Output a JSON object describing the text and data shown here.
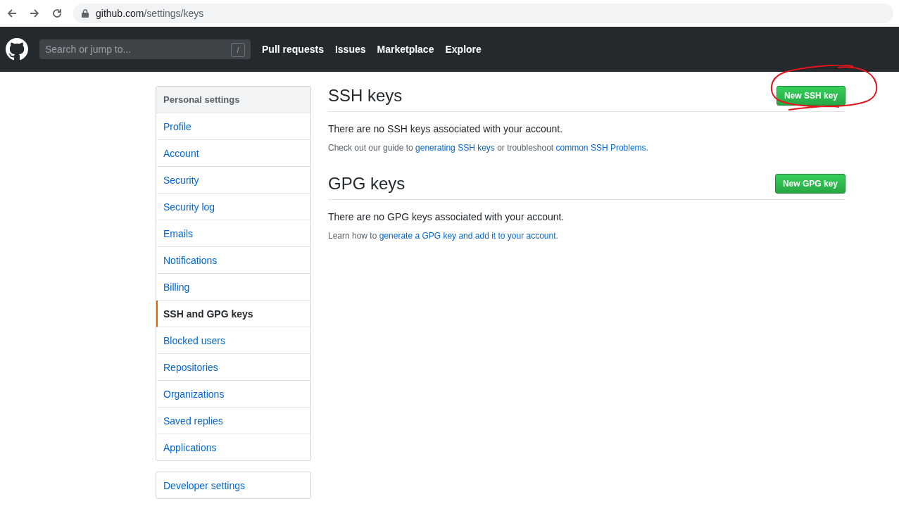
{
  "browser": {
    "url_host": "github.com",
    "url_path": "/settings/keys"
  },
  "header": {
    "search": {
      "placeholder": "Search or jump to..."
    },
    "slash_key": "/",
    "nav": [
      "Pull requests",
      "Issues",
      "Marketplace",
      "Explore"
    ]
  },
  "sidebar": {
    "heading": "Personal settings",
    "items": [
      {
        "label": "Profile",
        "selected": false
      },
      {
        "label": "Account",
        "selected": false
      },
      {
        "label": "Security",
        "selected": false
      },
      {
        "label": "Security log",
        "selected": false
      },
      {
        "label": "Emails",
        "selected": false
      },
      {
        "label": "Notifications",
        "selected": false
      },
      {
        "label": "Billing",
        "selected": false
      },
      {
        "label": "SSH and GPG keys",
        "selected": true
      },
      {
        "label": "Blocked users",
        "selected": false
      },
      {
        "label": "Repositories",
        "selected": false
      },
      {
        "label": "Organizations",
        "selected": false
      },
      {
        "label": "Saved replies",
        "selected": false
      },
      {
        "label": "Applications",
        "selected": false
      }
    ],
    "developer": "Developer settings"
  },
  "sections": [
    {
      "title": "SSH keys",
      "button": "New SSH key",
      "empty": "There are no SSH keys associated with your account.",
      "help": [
        {
          "text": "Check out our guide to ",
          "link": false
        },
        {
          "text": "generating SSH keys",
          "link": true
        },
        {
          "text": " or troubleshoot ",
          "link": false
        },
        {
          "text": "common SSH Problems",
          "link": true
        },
        {
          "text": ".",
          "link": false
        }
      ],
      "annotation": {
        "kind": "circle"
      }
    },
    {
      "title": "GPG keys",
      "button": "New GPG key",
      "empty": "There are no GPG keys associated with your account.",
      "help": [
        {
          "text": "Learn how to ",
          "link": false
        },
        {
          "text": "generate a GPG key and add it to your account",
          "link": true
        },
        {
          "text": ".",
          "link": false
        }
      ]
    }
  ]
}
